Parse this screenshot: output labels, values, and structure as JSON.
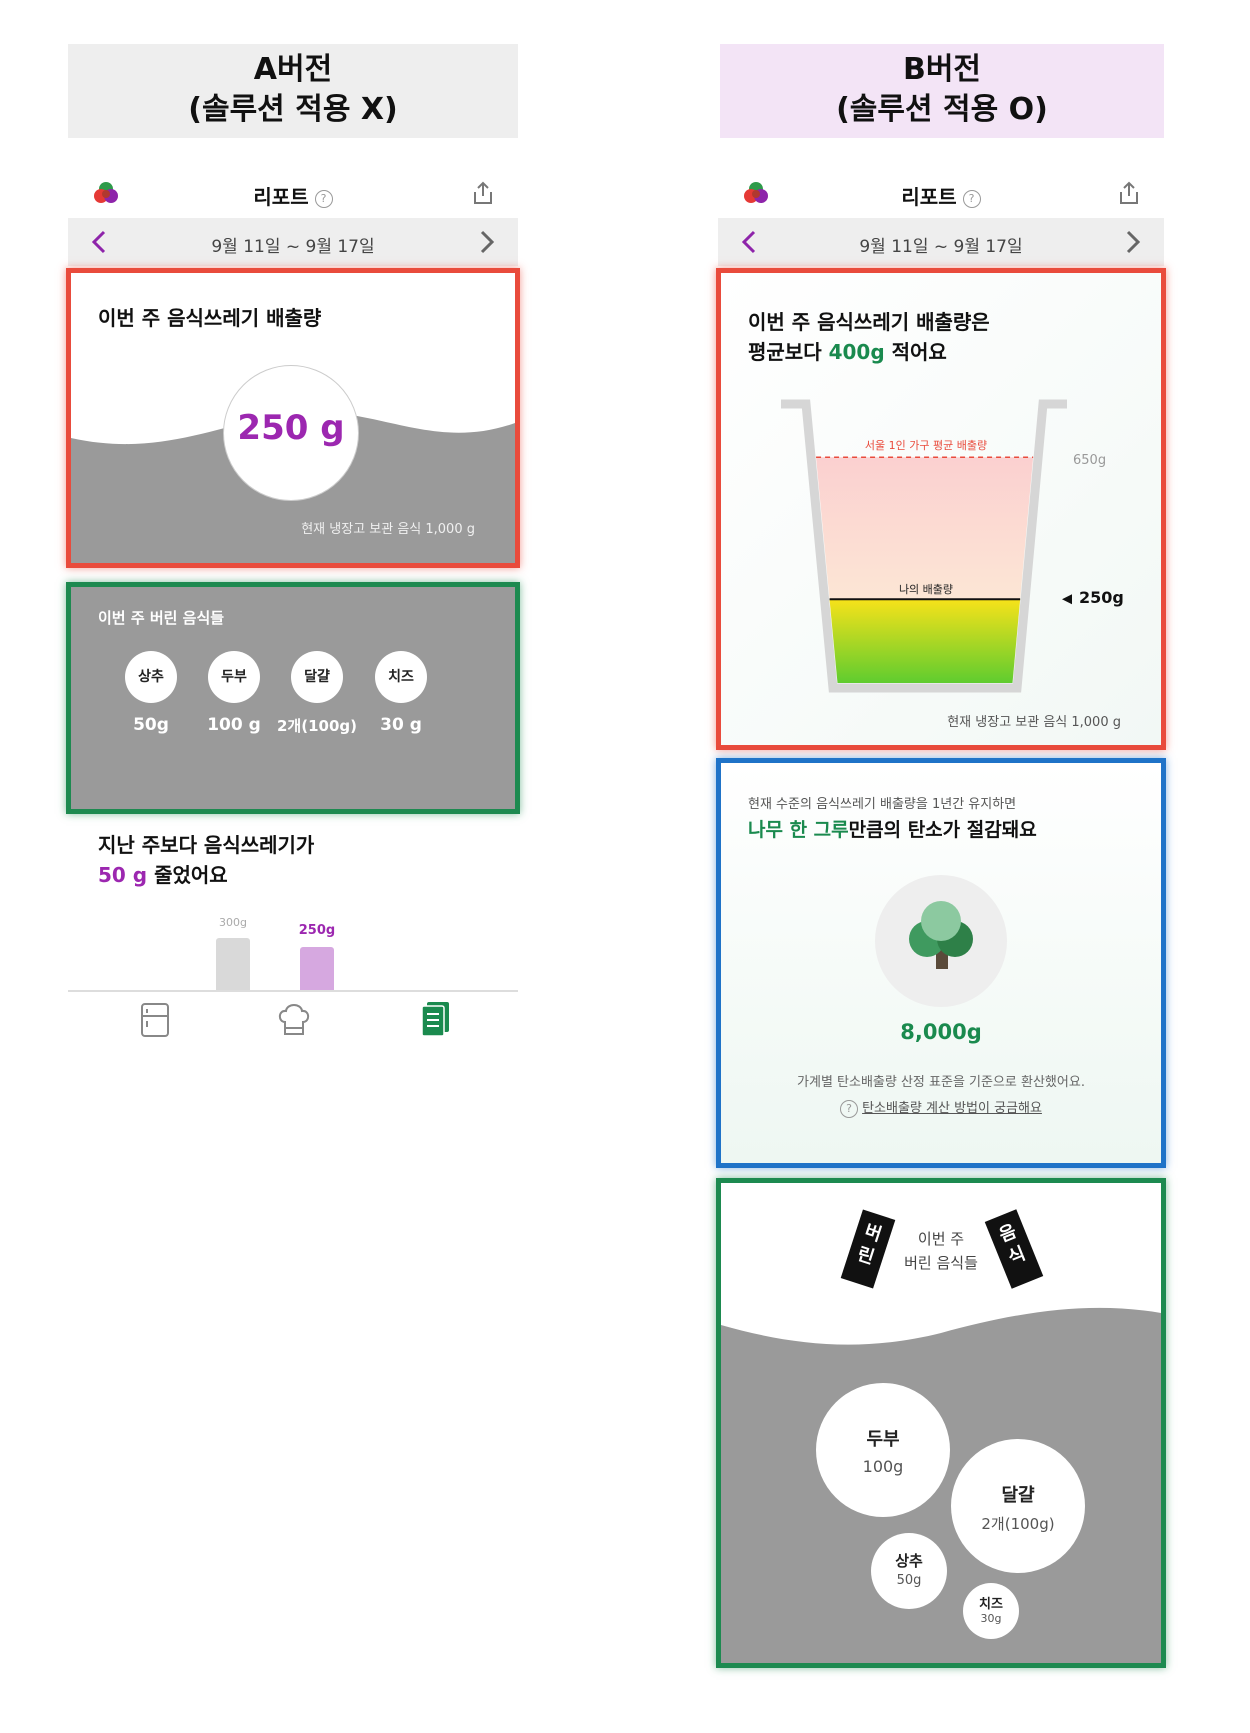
{
  "version_a": {
    "header_line1": "A버전",
    "header_line2": "(솔루션 적용 X)",
    "header_bg": "#eeeeee",
    "app": {
      "title": "리포트",
      "help_icon": "?",
      "date_range": "9월 11일 ~ 9월 17일",
      "weekly_waste": {
        "title": "이번 주 음식쓰레기 배출량",
        "amount": "250 g",
        "fridge_note": "현재 냉장고 보관 음식 1,000 g"
      },
      "discarded": {
        "title": "이번 주 버린 음식들",
        "items": [
          {
            "name": "상추",
            "amount": "50g"
          },
          {
            "name": "두부",
            "amount": "100 g"
          },
          {
            "name": "달걀",
            "amount": "2개(100g)"
          },
          {
            "name": "치즈",
            "amount": "30 g"
          }
        ]
      },
      "comparison": {
        "line1": "지난 주보다 음식쓰레기가",
        "highlight": "50 g",
        "line2_rest": " 줄었어요",
        "bars": [
          {
            "label": "300g",
            "value": 300,
            "color": "#d9d9d9",
            "label_color": "#aaaaaa"
          },
          {
            "label": "250g",
            "value": 250,
            "color": "#d6a8e0",
            "label_color": "#9c27b0"
          }
        ]
      },
      "bottom_nav": [
        {
          "icon": "fridge-icon",
          "active": false
        },
        {
          "icon": "chef-hat-icon",
          "active": false
        },
        {
          "icon": "report-icon",
          "active": true
        }
      ]
    }
  },
  "version_b": {
    "header_line1": "B버전",
    "header_line2": "(솔루션 적용 O)",
    "header_bg": "#f3e4f6",
    "app": {
      "title": "리포트",
      "help_icon": "?",
      "date_range": "9월 11일 ~ 9월 17일",
      "weekly_waste": {
        "title_line1": "이번 주 음식쓰레기 배출량은",
        "title_line2_pre": "평균보다 ",
        "title_highlight": "400g",
        "title_line2_post": " 적어요",
        "avg_label": "서울 1인 가구 평균 배출량",
        "avg_value": "650g",
        "my_label": "나의 배출량",
        "my_value": "250g",
        "average_g": 650,
        "mine_g": 250,
        "fridge_note": "현재 냉장고 보관 음식 1,000 g"
      },
      "carbon": {
        "subtitle": "현재 수준의 음식쓰레기 배출량을 1년간 유지하면",
        "headline_highlight": "나무 한 그루",
        "headline_rest": "만큼의 탄소가 절감돼요",
        "amount": "8,000g",
        "note": "가계별 탄소배출량 산정 표준을 기준으로 환산했어요.",
        "help_link": "탄소배출량 계산 방법이 궁금해요"
      },
      "discarded": {
        "title_line1": "이번 주",
        "title_line2": "버린 음식들",
        "tag_left": [
          "버",
          "린"
        ],
        "tag_right": [
          "음",
          "식"
        ],
        "items": [
          {
            "name": "두부",
            "amount": "100g"
          },
          {
            "name": "달걀",
            "amount": "2개(100g)"
          },
          {
            "name": "상추",
            "amount": "50g"
          },
          {
            "name": "치즈",
            "amount": "30g"
          }
        ]
      }
    }
  },
  "colors": {
    "purple": "#9c27b0",
    "green": "#1a8a4e",
    "gray_panel": "#9a9a9a",
    "red_outline": "#e94b3c",
    "green_outline": "#1d8a50",
    "blue_outline": "#1f73c8"
  }
}
